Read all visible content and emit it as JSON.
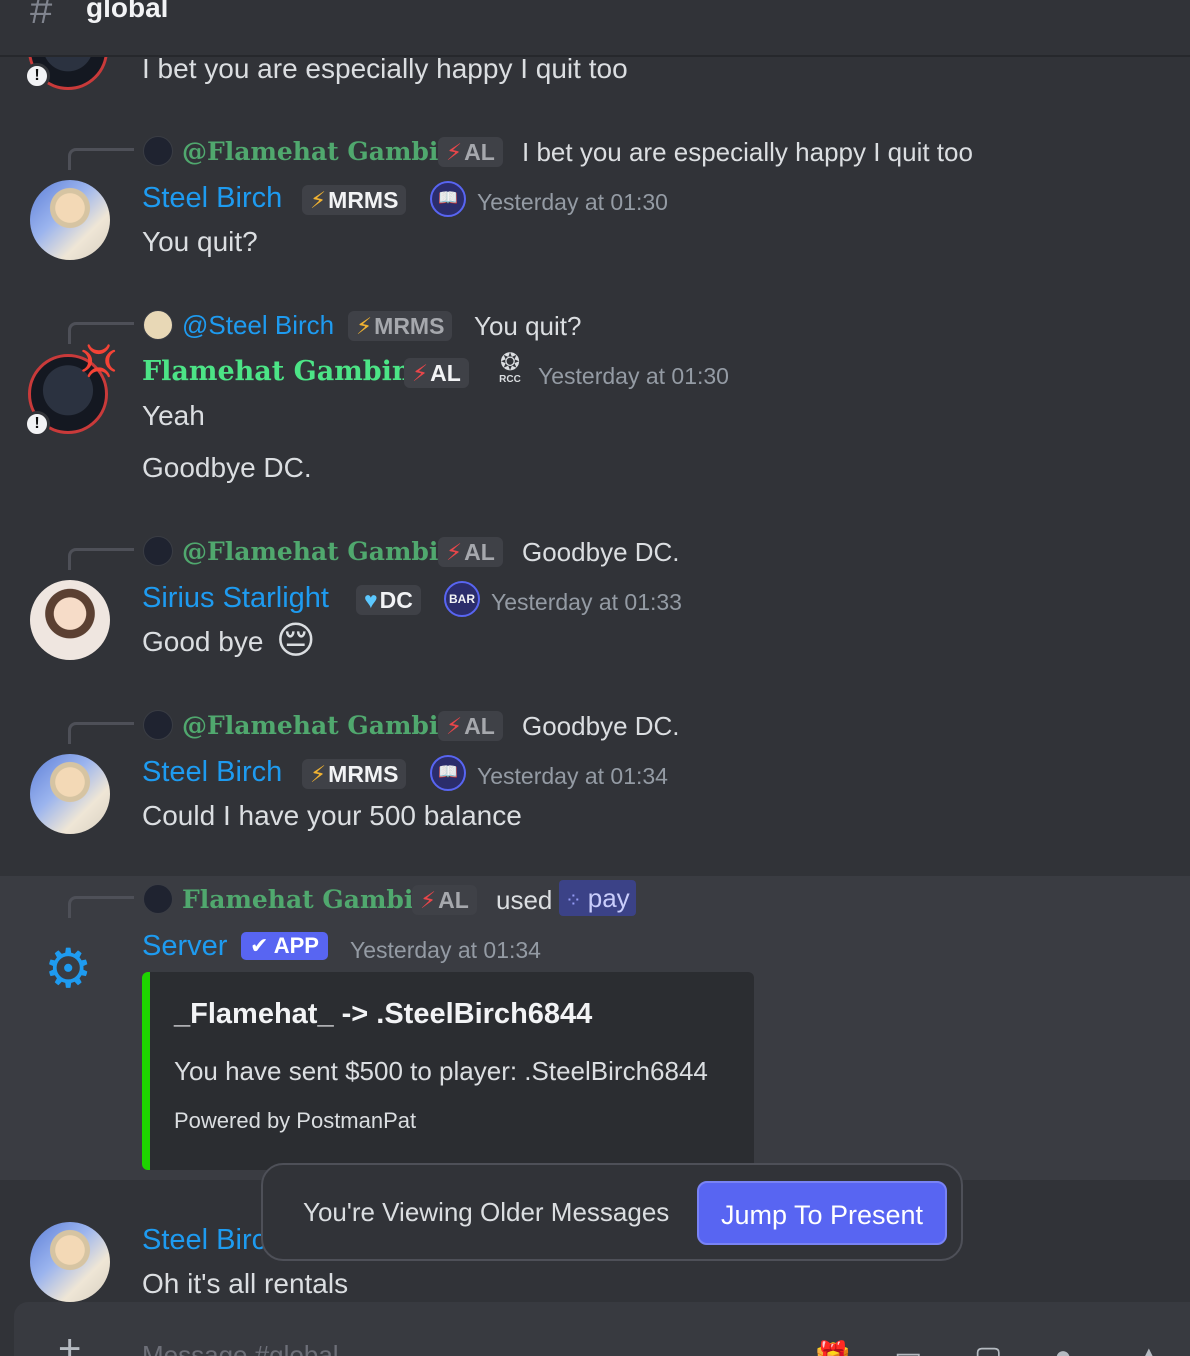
{
  "header": {
    "hash": "#",
    "channel": "global"
  },
  "first_message": {
    "text": "I bet you are especially happy I quit too"
  },
  "messages": [
    {
      "reply": {
        "name": "@Flamehat Gambino",
        "tag": "AL",
        "text": "I bet you are especially happy I quit too"
      },
      "author": "Steel Birch",
      "tag": "MRMS",
      "badge": "📖",
      "time": "Yesterday at 01:30",
      "lines": [
        "You quit?"
      ]
    },
    {
      "reply": {
        "name": "@Steel Birch",
        "tag": "MRMS",
        "text": "You quit?"
      },
      "author": "Flamehat Gambino",
      "tag": "AL",
      "badge": "RCC",
      "time": "Yesterday at 01:30",
      "lines": [
        "Yeah",
        "Goodbye DC."
      ]
    },
    {
      "reply": {
        "name": "@Flamehat Gambino",
        "tag": "AL",
        "text": "Goodbye DC."
      },
      "author": "Sirius Starlight",
      "tag": "DC",
      "badge": "BAR",
      "time": "Yesterday at 01:33",
      "lines": [
        "Good bye"
      ],
      "emoji": "😔"
    },
    {
      "reply": {
        "name": "@Flamehat Gambino",
        "tag": "AL",
        "text": "Goodbye DC."
      },
      "author": "Steel Birch",
      "tag": "MRMS",
      "badge": "📖",
      "time": "Yesterday at 01:34",
      "lines": [
        "Could I have your 500 balance"
      ]
    }
  ],
  "app_message": {
    "reply": {
      "name": "Flamehat Gambino",
      "tag": "AL",
      "used": "used",
      "command": "pay"
    },
    "author": "Server",
    "app_badge": "✔ APP",
    "time": "Yesterday at 01:34",
    "embed": {
      "title": "_Flamehat_ -> .SteelBirch6844",
      "description": "You have sent $500 to player: .SteelBirch6844",
      "footer": "Powered by PostmanPat",
      "color": "#1ed400"
    }
  },
  "last_message": {
    "author": "Steel Birch",
    "text": "Oh it's all rentals"
  },
  "older_bar": {
    "text": "You're Viewing Older Messages",
    "button": "Jump To Present"
  },
  "composer": {
    "placeholder": "Message #global"
  },
  "colors": {
    "background": "#313338",
    "accent": "#5865f2",
    "name_blue": "#1e9bf0",
    "name_green": "#4ce486"
  }
}
